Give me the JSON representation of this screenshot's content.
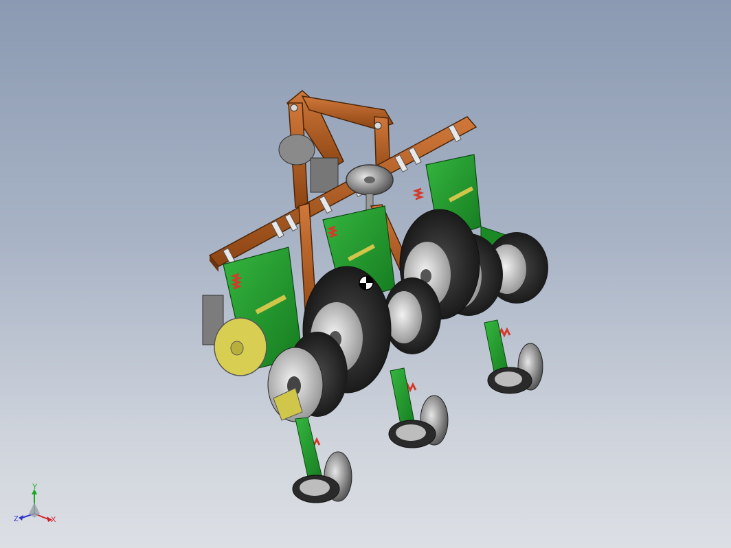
{
  "viewport": {
    "background_top": "#8b9ab2",
    "background_bottom": "#dcdfe4"
  },
  "model": {
    "description_icon": "planter-assembly-3d-icon",
    "colors": {
      "frame": "#b8611e",
      "frame_dark": "#7e3f12",
      "body_green": "#1f9a2b",
      "green_dark": "#0f5e17",
      "tire": "#2c2c2c",
      "rim": "#cfcfcf",
      "disc": "#9a9a9a",
      "yellow": "#cfc64a",
      "spring": "#d23a2a"
    }
  },
  "triad": {
    "x_label": "X",
    "y_label": "Y",
    "z_label": "Z",
    "x_color": "#d0202a",
    "y_color": "#18a81e",
    "z_color": "#2a35c8"
  }
}
